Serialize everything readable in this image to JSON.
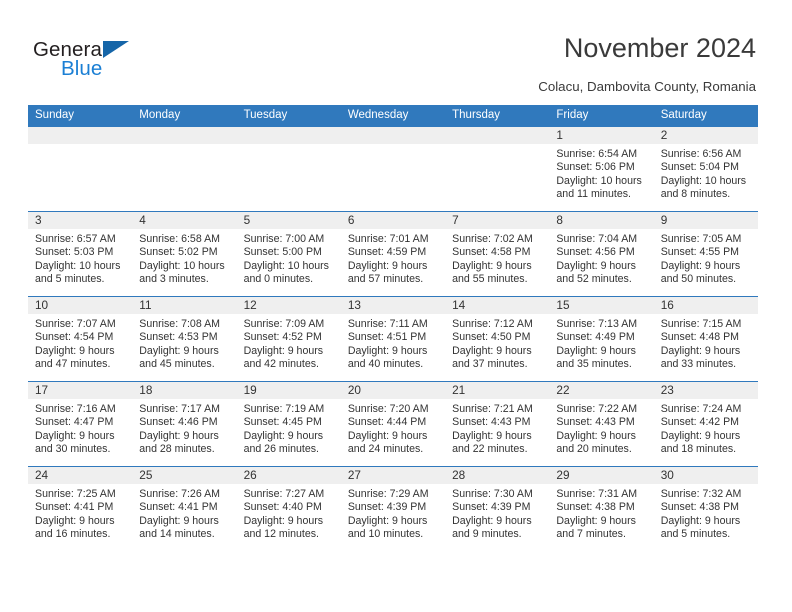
{
  "brand": {
    "line1": "General",
    "line2": "Blue",
    "triangle_color": "#1565a8",
    "blue_color": "#1b7fd4"
  },
  "header": {
    "title": "November 2024",
    "location": "Colacu, Dambovita County, Romania"
  },
  "theme": {
    "header_blue": "#3079bd",
    "daynum_band": "#efefef",
    "text": "#333333"
  },
  "calendar": {
    "weekday_headers": [
      "Sunday",
      "Monday",
      "Tuesday",
      "Wednesday",
      "Thursday",
      "Friday",
      "Saturday"
    ],
    "weeks": [
      [
        {
          "day": "",
          "lines": []
        },
        {
          "day": "",
          "lines": []
        },
        {
          "day": "",
          "lines": []
        },
        {
          "day": "",
          "lines": []
        },
        {
          "day": "",
          "lines": []
        },
        {
          "day": "1",
          "lines": [
            "Sunrise: 6:54 AM",
            "Sunset: 5:06 PM",
            "Daylight: 10 hours",
            "and 11 minutes."
          ]
        },
        {
          "day": "2",
          "lines": [
            "Sunrise: 6:56 AM",
            "Sunset: 5:04 PM",
            "Daylight: 10 hours",
            "and 8 minutes."
          ]
        }
      ],
      [
        {
          "day": "3",
          "lines": [
            "Sunrise: 6:57 AM",
            "Sunset: 5:03 PM",
            "Daylight: 10 hours",
            "and 5 minutes."
          ]
        },
        {
          "day": "4",
          "lines": [
            "Sunrise: 6:58 AM",
            "Sunset: 5:02 PM",
            "Daylight: 10 hours",
            "and 3 minutes."
          ]
        },
        {
          "day": "5",
          "lines": [
            "Sunrise: 7:00 AM",
            "Sunset: 5:00 PM",
            "Daylight: 10 hours",
            "and 0 minutes."
          ]
        },
        {
          "day": "6",
          "lines": [
            "Sunrise: 7:01 AM",
            "Sunset: 4:59 PM",
            "Daylight: 9 hours",
            "and 57 minutes."
          ]
        },
        {
          "day": "7",
          "lines": [
            "Sunrise: 7:02 AM",
            "Sunset: 4:58 PM",
            "Daylight: 9 hours",
            "and 55 minutes."
          ]
        },
        {
          "day": "8",
          "lines": [
            "Sunrise: 7:04 AM",
            "Sunset: 4:56 PM",
            "Daylight: 9 hours",
            "and 52 minutes."
          ]
        },
        {
          "day": "9",
          "lines": [
            "Sunrise: 7:05 AM",
            "Sunset: 4:55 PM",
            "Daylight: 9 hours",
            "and 50 minutes."
          ]
        }
      ],
      [
        {
          "day": "10",
          "lines": [
            "Sunrise: 7:07 AM",
            "Sunset: 4:54 PM",
            "Daylight: 9 hours",
            "and 47 minutes."
          ]
        },
        {
          "day": "11",
          "lines": [
            "Sunrise: 7:08 AM",
            "Sunset: 4:53 PM",
            "Daylight: 9 hours",
            "and 45 minutes."
          ]
        },
        {
          "day": "12",
          "lines": [
            "Sunrise: 7:09 AM",
            "Sunset: 4:52 PM",
            "Daylight: 9 hours",
            "and 42 minutes."
          ]
        },
        {
          "day": "13",
          "lines": [
            "Sunrise: 7:11 AM",
            "Sunset: 4:51 PM",
            "Daylight: 9 hours",
            "and 40 minutes."
          ]
        },
        {
          "day": "14",
          "lines": [
            "Sunrise: 7:12 AM",
            "Sunset: 4:50 PM",
            "Daylight: 9 hours",
            "and 37 minutes."
          ]
        },
        {
          "day": "15",
          "lines": [
            "Sunrise: 7:13 AM",
            "Sunset: 4:49 PM",
            "Daylight: 9 hours",
            "and 35 minutes."
          ]
        },
        {
          "day": "16",
          "lines": [
            "Sunrise: 7:15 AM",
            "Sunset: 4:48 PM",
            "Daylight: 9 hours",
            "and 33 minutes."
          ]
        }
      ],
      [
        {
          "day": "17",
          "lines": [
            "Sunrise: 7:16 AM",
            "Sunset: 4:47 PM",
            "Daylight: 9 hours",
            "and 30 minutes."
          ]
        },
        {
          "day": "18",
          "lines": [
            "Sunrise: 7:17 AM",
            "Sunset: 4:46 PM",
            "Daylight: 9 hours",
            "and 28 minutes."
          ]
        },
        {
          "day": "19",
          "lines": [
            "Sunrise: 7:19 AM",
            "Sunset: 4:45 PM",
            "Daylight: 9 hours",
            "and 26 minutes."
          ]
        },
        {
          "day": "20",
          "lines": [
            "Sunrise: 7:20 AM",
            "Sunset: 4:44 PM",
            "Daylight: 9 hours",
            "and 24 minutes."
          ]
        },
        {
          "day": "21",
          "lines": [
            "Sunrise: 7:21 AM",
            "Sunset: 4:43 PM",
            "Daylight: 9 hours",
            "and 22 minutes."
          ]
        },
        {
          "day": "22",
          "lines": [
            "Sunrise: 7:22 AM",
            "Sunset: 4:43 PM",
            "Daylight: 9 hours",
            "and 20 minutes."
          ]
        },
        {
          "day": "23",
          "lines": [
            "Sunrise: 7:24 AM",
            "Sunset: 4:42 PM",
            "Daylight: 9 hours",
            "and 18 minutes."
          ]
        }
      ],
      [
        {
          "day": "24",
          "lines": [
            "Sunrise: 7:25 AM",
            "Sunset: 4:41 PM",
            "Daylight: 9 hours",
            "and 16 minutes."
          ]
        },
        {
          "day": "25",
          "lines": [
            "Sunrise: 7:26 AM",
            "Sunset: 4:41 PM",
            "Daylight: 9 hours",
            "and 14 minutes."
          ]
        },
        {
          "day": "26",
          "lines": [
            "Sunrise: 7:27 AM",
            "Sunset: 4:40 PM",
            "Daylight: 9 hours",
            "and 12 minutes."
          ]
        },
        {
          "day": "27",
          "lines": [
            "Sunrise: 7:29 AM",
            "Sunset: 4:39 PM",
            "Daylight: 9 hours",
            "and 10 minutes."
          ]
        },
        {
          "day": "28",
          "lines": [
            "Sunrise: 7:30 AM",
            "Sunset: 4:39 PM",
            "Daylight: 9 hours",
            "and 9 minutes."
          ]
        },
        {
          "day": "29",
          "lines": [
            "Sunrise: 7:31 AM",
            "Sunset: 4:38 PM",
            "Daylight: 9 hours",
            "and 7 minutes."
          ]
        },
        {
          "day": "30",
          "lines": [
            "Sunrise: 7:32 AM",
            "Sunset: 4:38 PM",
            "Daylight: 9 hours",
            "and 5 minutes."
          ]
        }
      ]
    ]
  }
}
